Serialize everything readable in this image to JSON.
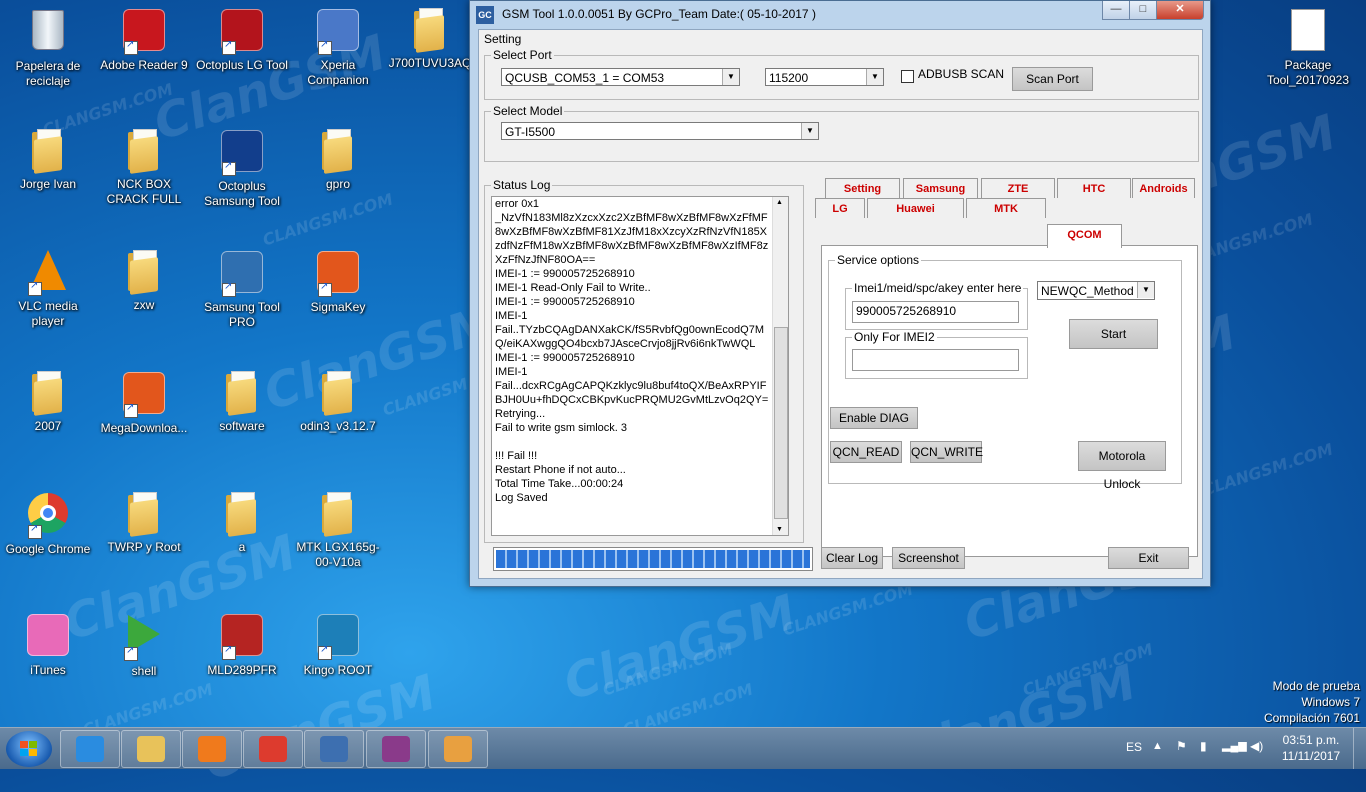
{
  "desktop": {
    "icons": [
      {
        "label": "Papelera de reciclaje",
        "icon": "recycle-bin-icon"
      },
      {
        "label": "Adobe Reader 9",
        "icon": "adobe-reader-icon"
      },
      {
        "label": "Octoplus LG Tool",
        "icon": "octoplus-lg-icon"
      },
      {
        "label": "Xperia Companion",
        "icon": "xperia-icon"
      },
      {
        "label": "J700TUVU3AQ",
        "icon": "folder-icon"
      },
      {
        "label": "Jorge Ivan",
        "icon": "folder-icon"
      },
      {
        "label": "NCK BOX CRACK FULL",
        "icon": "folder-icon"
      },
      {
        "label": "Octoplus Samsung Tool",
        "icon": "octoplus-samsung-icon"
      },
      {
        "label": "gpro",
        "icon": "folder-icon"
      },
      {
        "label": "VLC media player",
        "icon": "vlc-icon"
      },
      {
        "label": "zxw",
        "icon": "folder-icon"
      },
      {
        "label": "Samsung Tool PRO",
        "icon": "samsung-tool-icon"
      },
      {
        "label": "SigmaKey",
        "icon": "sigmakey-icon"
      },
      {
        "label": "2007",
        "icon": "folder-icon"
      },
      {
        "label": "MegaDownloa...",
        "icon": "mega-icon"
      },
      {
        "label": "software",
        "icon": "folder-icon"
      },
      {
        "label": "odin3_v3.12.7",
        "icon": "folder-icon"
      },
      {
        "label": "Google Chrome",
        "icon": "chrome-icon"
      },
      {
        "label": "TWRP y Root",
        "icon": "folder-icon"
      },
      {
        "label": "a",
        "icon": "folder-icon"
      },
      {
        "label": "MTK LGX165g-00-V10a",
        "icon": "folder-icon"
      },
      {
        "label": "iTunes",
        "icon": "itunes-icon"
      },
      {
        "label": "shell",
        "icon": "shell-icon"
      },
      {
        "label": "MLD289PFR",
        "icon": "pdf-icon"
      },
      {
        "label": "Kingo ROOT",
        "icon": "kingo-root-icon"
      },
      {
        "label": "Package Tool_20170923",
        "icon": "file-icon"
      }
    ],
    "watermark": "ClanGSM",
    "watermark_small": "CLANGSM.COM"
  },
  "window": {
    "title": "GSM Tool 1.0.0.0051 By GCPro_Team  Date:( 05-10-2017 )",
    "app_icon": "GC",
    "controls": {
      "minimize": "—",
      "maximize": "□",
      "close": "✕"
    },
    "menu_tab": "Setting",
    "select_port": {
      "legend": "Select Port",
      "port_value": "QCUSB_COM53_1 = COM53",
      "baud_value": "115200",
      "adb_label": "ADBUSB SCAN",
      "scan_button": "Scan Port"
    },
    "select_model": {
      "legend": "Select Model",
      "model_value": "GT-I5500"
    },
    "status_log": {
      "legend": "Status Log",
      "lines": [
        "error 0x1",
        "_NzVfN183Ml8zXzcxXzc2XzBfMF8wXzBfMF8wXzFfMF8wXzBfMF8wXzBfMF81XzJfM18xXzcyXzRfNzVfN185XzdfNzFfM18wXzBfMF8wXzBfMF8wXzBfMF8wXzIfMF8zXzFfNzJfNF80OA==",
        "IMEI-1 := 990005725268910",
        "IMEI-1 Read-Only Fail to Write..",
        "IMEI-1 := 990005725268910",
        "IMEI-1",
        "Fail..TYzbCQAgDANXakCK/fS5RvbfQg0ownEcodQ7MQ/eiKAXwggQO4bcxb7JAsceCrvjo8jjRv6i6nkTwWQL",
        "IMEI-1 := 990005725268910",
        "IMEI-1",
        "Fail...dcxRCgAgCAPQKzklyc9lu8buf4toQX/BeAxRPYIFBJH0Uu+fhDQCxCBKpvKucPRQMU2GvMtLzvOq2QY=",
        "Retrying...",
        "Fail to write gsm simlock. 3",
        "",
        "!!! Fail !!!",
        "Restart Phone if not auto...",
        "Total Time Take...00:00:24",
        "Log Saved"
      ]
    },
    "progress": {
      "fraction": 1.0
    },
    "tabs_row1": [
      "Setting",
      "Samsung",
      "ZTE",
      "HTC",
      "Androids"
    ],
    "tabs_row2": [
      "LG",
      "Huawei",
      "MTK",
      "QCOM"
    ],
    "active_tab": "QCOM",
    "service": {
      "legend": "Service options",
      "imei_legend": "Imei1/meid/spc/akey enter here",
      "imei_value": "990005725268910",
      "imei2_legend": "Only For IMEI2",
      "imei2_value": "",
      "method_value": "NEWQC_Method",
      "start_button": "Start",
      "enable_diag": "Enable DIAG",
      "qcn_read": "QCN_READ",
      "qcn_write": "QCN_WRITE",
      "motorola_unlock": "Motorola Unlock"
    },
    "bottom_buttons": {
      "clear_log": "Clear Log",
      "screenshot": "Screenshot",
      "exit": "Exit"
    }
  },
  "os_watermark": {
    "line1": "Modo de prueba",
    "line2": "Windows 7",
    "line3": "Compilación 7601"
  },
  "taskbar": {
    "pinned": [
      "ie-icon",
      "explorer-icon",
      "media-player-icon",
      "chrome-icon",
      "gc-tool-icon",
      "winrar-icon",
      "paint-icon"
    ],
    "language": "ES",
    "time": "03:51 p.m.",
    "date": "11/11/2017"
  }
}
